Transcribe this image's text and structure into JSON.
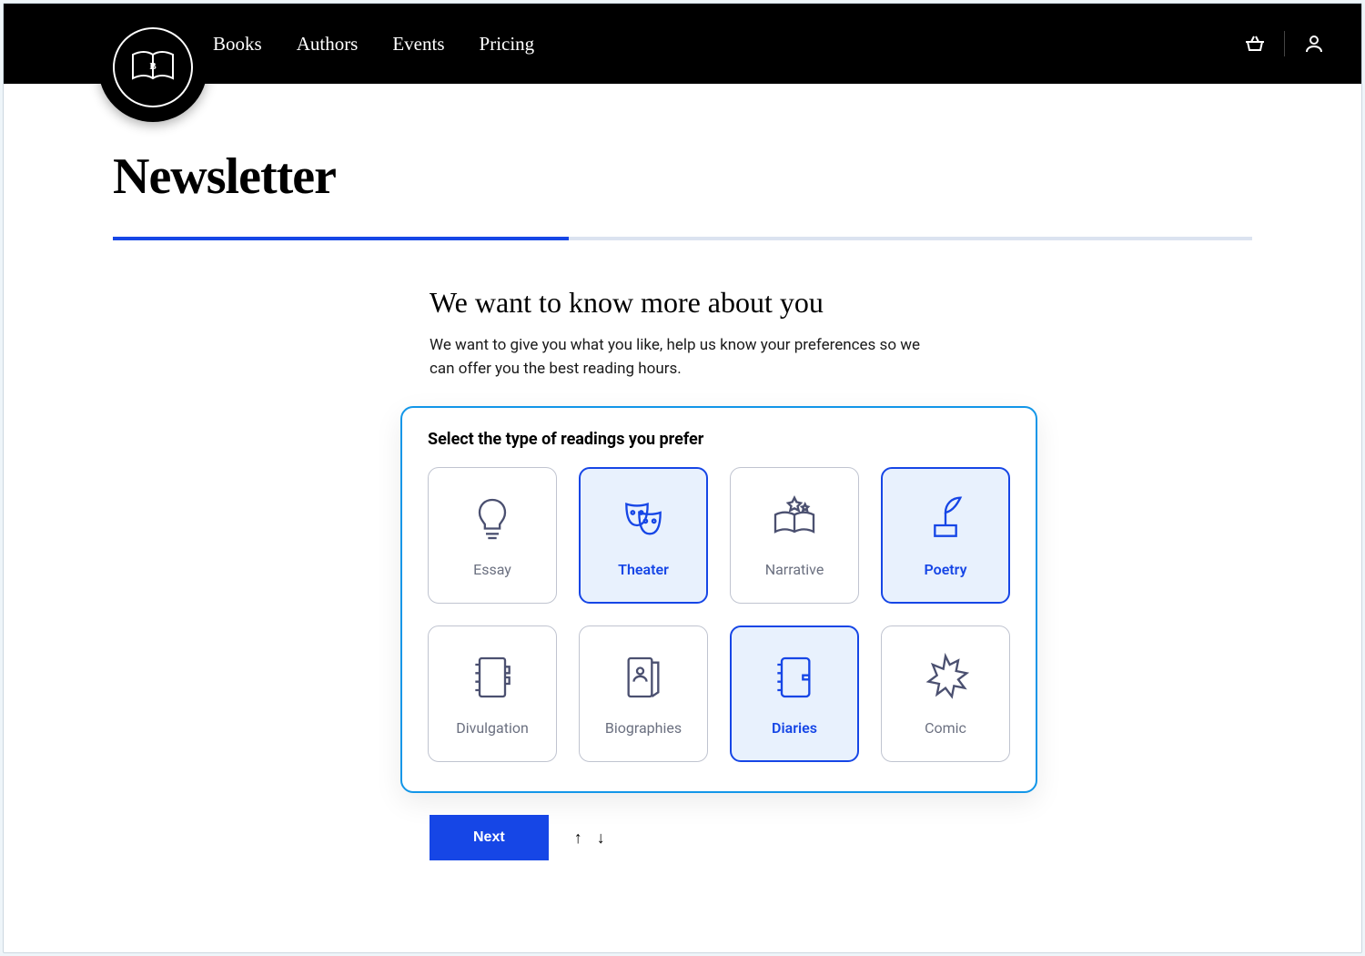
{
  "nav": {
    "items": [
      "Books",
      "Authors",
      "Events",
      "Pricing"
    ]
  },
  "logo_letter": "B",
  "page": {
    "title": "Newsletter",
    "progress_percent": 40,
    "heading": "We want to know more about you",
    "description": "We want to give you what you like, help us know your preferences so we can offer you the best reading hours."
  },
  "panel": {
    "title": "Select the type of readings you prefer",
    "tiles": [
      {
        "label": "Essay",
        "icon": "lightbulb",
        "selected": false
      },
      {
        "label": "Theater",
        "icon": "masks",
        "selected": true
      },
      {
        "label": "Narrative",
        "icon": "book-stars",
        "selected": false
      },
      {
        "label": "Poetry",
        "icon": "quill",
        "selected": true
      },
      {
        "label": "Divulgation",
        "icon": "notebook-tabs",
        "selected": false
      },
      {
        "label": "Biographies",
        "icon": "id-book",
        "selected": false
      },
      {
        "label": "Diaries",
        "icon": "diary",
        "selected": true
      },
      {
        "label": "Comic",
        "icon": "burst",
        "selected": false
      }
    ]
  },
  "actions": {
    "next_label": "Next"
  }
}
